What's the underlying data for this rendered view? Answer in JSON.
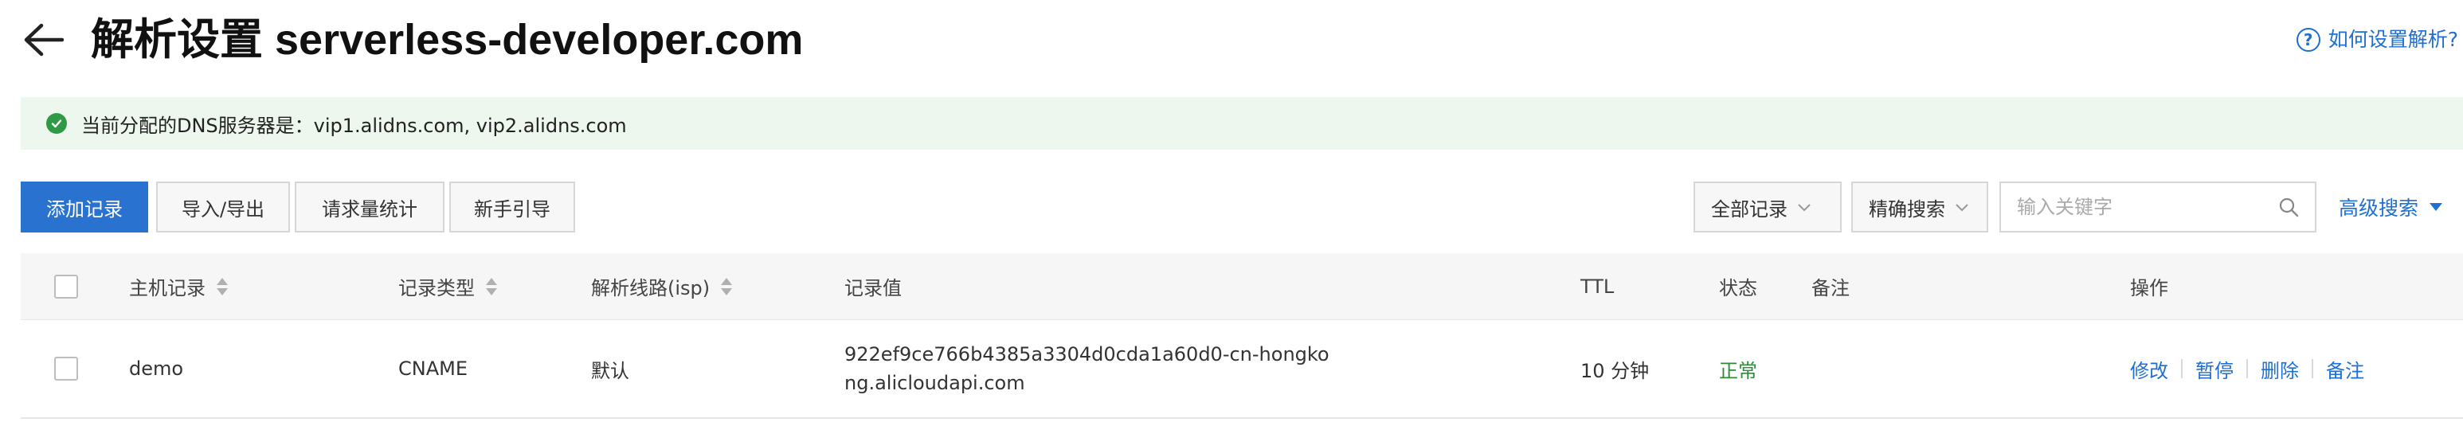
{
  "header": {
    "title": "解析设置 serverless-developer.com",
    "help_icon": "?",
    "help_text": "如何设置解析?"
  },
  "notice": {
    "text": "当前分配的DNS服务器是：vip1.alidns.com, vip2.alidns.com",
    "status_color": "#2e9a45"
  },
  "toolbar": {
    "add_record": "添加记录",
    "import_export": "导入/导出",
    "request_stats": "请求量统计",
    "beginner_guide": "新手引导",
    "record_filter": "全部记录",
    "search_mode": "精确搜索",
    "search_placeholder": "输入关键字",
    "search_value": "",
    "advanced_search": "高级搜索",
    "accent_color": "#2a72d0"
  },
  "table": {
    "columns": {
      "host": "主机记录",
      "type": "记录类型",
      "line": "解析线路(isp)",
      "value": "记录值",
      "ttl": "TTL",
      "status": "状态",
      "remark": "备注",
      "actions": "操作"
    },
    "rows": [
      {
        "host": "demo",
        "type": "CNAME",
        "line": "默认",
        "value_line1": "922ef9ce766b4385a3304d0cda1a60d0-cn-hongko",
        "value_line2": "ng.alicloudapi.com",
        "ttl": "10 分钟",
        "status": "正常",
        "remark": "",
        "actions": {
          "edit": "修改",
          "pause": "暂停",
          "delete": "删除",
          "remark": "备注"
        }
      }
    ]
  }
}
